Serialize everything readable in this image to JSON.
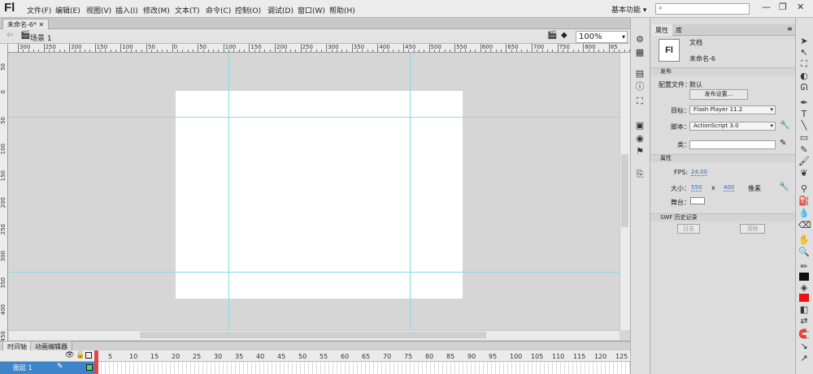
{
  "app": {
    "logo": "Fl"
  },
  "menu": {
    "items": [
      "文件(F)",
      "编辑(E)",
      "视图(V)",
      "插入(I)",
      "修改(M)",
      "文本(T)",
      "命令(C)",
      "控制(O)",
      "调试(D)",
      "窗口(W)",
      "帮助(H)"
    ]
  },
  "workspace": {
    "label": "基本功能",
    "search_placeholder": ""
  },
  "document": {
    "tab": "未命名-6*",
    "scene": "场景 1",
    "zoom": "100%"
  },
  "ruler": {
    "h": [
      "300",
      "250",
      "200",
      "150",
      "100",
      "50",
      "0",
      "50",
      "100",
      "150",
      "200",
      "250",
      "300",
      "350",
      "400",
      "450",
      "500",
      "550",
      "600",
      "650",
      "700",
      "750",
      "800",
      "85"
    ],
    "v": [
      "50",
      "0",
      "50",
      "100",
      "150",
      "200",
      "250",
      "300",
      "350",
      "400",
      "450"
    ]
  },
  "timeline": {
    "tabs": [
      "时间轴",
      "动画编辑器"
    ],
    "layer_name": "图层 1",
    "frames": [
      "5",
      "10",
      "15",
      "20",
      "25",
      "30",
      "35",
      "40",
      "45",
      "50",
      "55",
      "60",
      "65",
      "70",
      "75",
      "80",
      "85",
      "90",
      "95",
      "100",
      "105",
      "110",
      "115",
      "120",
      "125"
    ]
  },
  "panel": {
    "tabs": [
      "属性",
      "库"
    ],
    "doc_icon": "Fl",
    "doc_type": "文档",
    "doc_name": "未命名-6",
    "publish": {
      "header": "发布",
      "profile_label": "配置文件：",
      "profile_value": "默认",
      "settings_button": "发布设置...",
      "target_label": "目标：",
      "target_value": "Flash Player 11.2",
      "script_label": "脚本：",
      "script_value": "ActionScript 3.0",
      "class_label": "类："
    },
    "properties": {
      "header": "属性",
      "fps_label": "FPS:",
      "fps_value": "24.00",
      "size_label": "大小：",
      "width": "550",
      "x": "x",
      "height": "400",
      "unit": "像素",
      "stage_label": "舞台："
    },
    "swf": {
      "header": "SWF 历史记录",
      "log_button": "日志",
      "clear_button": "清除"
    }
  },
  "colors": {
    "stage": "#ffffff",
    "guide": "#8ad8e8",
    "layer_selected": "#3d84c8",
    "playhead": "#e0454a",
    "fill": "#ee1111"
  }
}
